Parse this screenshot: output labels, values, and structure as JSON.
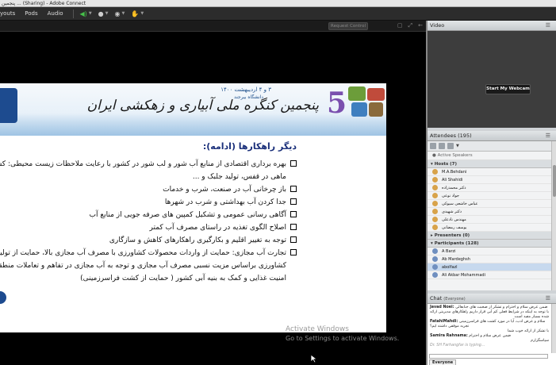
{
  "window": {
    "title": "پنجمین ... (Sharing) - Adobe Connect"
  },
  "menubar": {
    "items": [
      "youts",
      "Pods",
      "Audio"
    ],
    "controls": [
      {
        "name": "speaker-icon",
        "glyph": "◀)"
      },
      {
        "name": "microphone-icon",
        "glyph": "↓"
      },
      {
        "name": "webcam-icon",
        "glyph": "●"
      },
      {
        "name": "raise-hand-icon",
        "glyph": "✋"
      }
    ]
  },
  "share": {
    "request_control_label": "Request Control",
    "slide": {
      "logo_text": "ا",
      "title": "پنجمین کنگره ملی آبیاری و زهکشی ایران",
      "subtitle": "۳ و ۴ اردیبهشت ۱۴۰۰",
      "subtitle2": "دانشگاه بیرجند",
      "numeral": "5",
      "heading": "دیگر راهکارها (ادامه):",
      "bullets": [
        {
          "text": "بهره برداری اقتصادی از منابع آب شور و لب شور در کشور با رعایت ملاحظات زیست محیطی: کشت کینوا، آبزی پروری، پرورش",
          "cont": "ماهی در قفس، تولید جلبک و ..."
        },
        {
          "text": "باز چرخانی آب در صنعت، شرب و خدمات",
          "cont": ""
        },
        {
          "text": "جدا کردن آب بهداشتی و شرب در شهرها",
          "cont": ""
        },
        {
          "text": "آگاهی رسانی عمومی و تشکیل کمپین های صرفه جویی از منابع آب",
          "cont": ""
        },
        {
          "text": "اصلاح الگوی تغذیه در راستای مصرف آب کمتر",
          "cont": ""
        },
        {
          "text": "توجه به تغییر اقلیم و بکارگیری راهکارهای کاهش و سازگاری",
          "cont": ""
        },
        {
          "text": "تجارت آب مجازی: حمایت از واردات محصولات کشاورزی با مصرف آب مجازی بالا، حمایت از تولید و صادرات محصولات",
          "cont": "کشاورزی براساس مزیت نسبی مصرف آب مجازی و توجه به آب مجازی در تفاهم و تعاملات منطقه ای و بین المللی بمنظور تقویت",
          "cont2": "امنیت غذایی و کمک به بنیه آبی کشور ( حمایت از کشت فراسرزمینی)"
        }
      ]
    },
    "watermark": {
      "line1": "Activate Windows",
      "line2": "Go to Settings to activate Windows."
    }
  },
  "video": {
    "title": "Video",
    "start_webcam_label": "Start My Webcam"
  },
  "attendees": {
    "title": "Attendees",
    "count": "(195)",
    "active_speakers": "Active Speakers",
    "hosts_header": "Hosts (7)",
    "hosts": [
      "M.A.Behdani",
      "Ali Shahidi",
      "دکتر محمدزاده",
      "جواد نوعی",
      "عباس خاشعی سیوکی",
      "دکتر شهیدی",
      "مهندس نادعلی",
      "یوسف رمضانی"
    ],
    "presenters_header": "Presenters (0)",
    "participants_header": "Participants (128)",
    "participants": [
      "A Barzi",
      "Ab Mardeghsh",
      "abolfazl",
      "Ali Akbar Mohammadi"
    ]
  },
  "chat": {
    "title": "Chat",
    "scope": "(Everyone)",
    "messages": [
      {
        "name": "Javad Noei:",
        "text": "ضمن عرض سلام و احترام و تشکر از صحبت های جنابعالی"
      },
      {
        "name": "",
        "text": "با توجه به اینکه در شرایط فعلی کم آبی قرار داریم راهکارهای مدیریتی ارائه شده بسیار مفید است"
      },
      {
        "name": "FatahiMahdi:",
        "text": "سلام و عرض ادب، آیا در مورد کشت های فراسرزمینی تجربه موفقی داشته ایم؟"
      },
      {
        "name": "",
        "text": "با تشکر از ارائه خوب شما"
      },
      {
        "name": "Samira Rahnama:",
        "text": "ضمن عرض سلام و احترام"
      },
      {
        "name": "",
        "text": "سپاسگزارم"
      }
    ],
    "typing": "Dr. SH Farhangfar is typing...",
    "tab_label": "Everyone"
  }
}
